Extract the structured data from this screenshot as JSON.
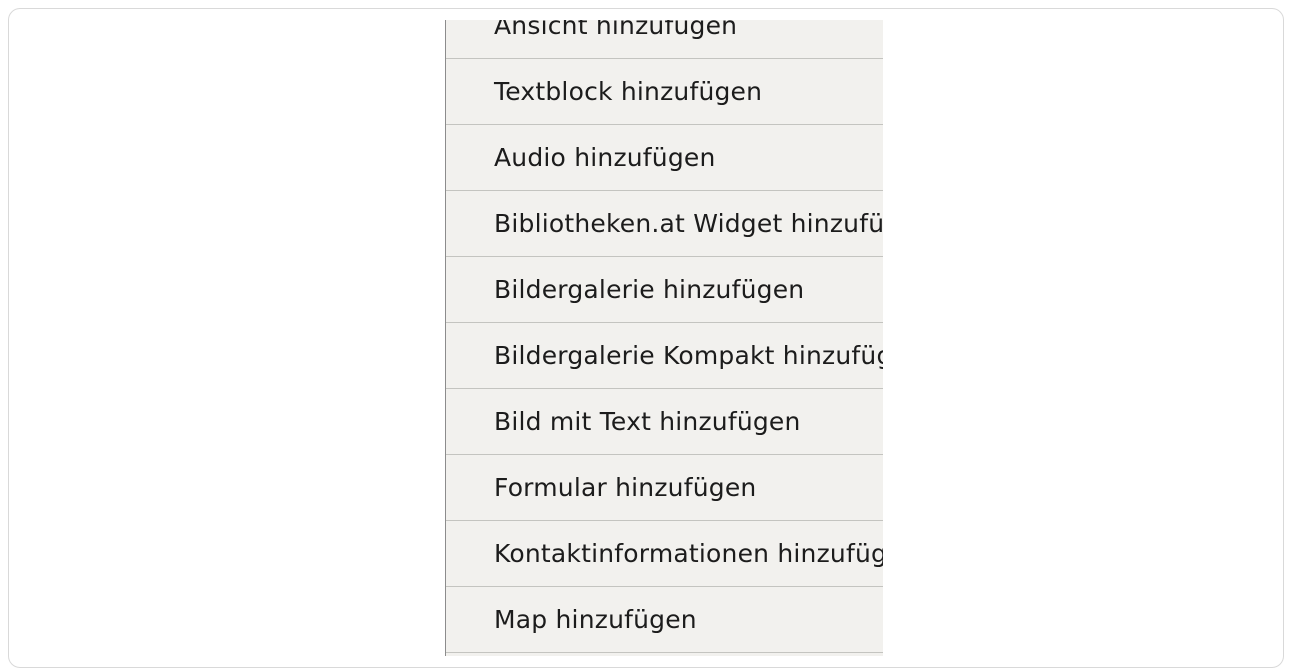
{
  "menu": {
    "items": [
      {
        "label": "Ansicht hinzufügen"
      },
      {
        "label": "Textblock hinzufügen"
      },
      {
        "label": "Audio hinzufügen"
      },
      {
        "label": "Bibliotheken.at Widget hinzufügen"
      },
      {
        "label": "Bildergalerie hinzufügen"
      },
      {
        "label": "Bildergalerie Kompakt hinzufügen"
      },
      {
        "label": "Bild mit Text hinzufügen"
      },
      {
        "label": "Formular hinzufügen"
      },
      {
        "label": "Kontaktinformationen hinzufügen"
      },
      {
        "label": "Map hinzufügen"
      }
    ]
  }
}
